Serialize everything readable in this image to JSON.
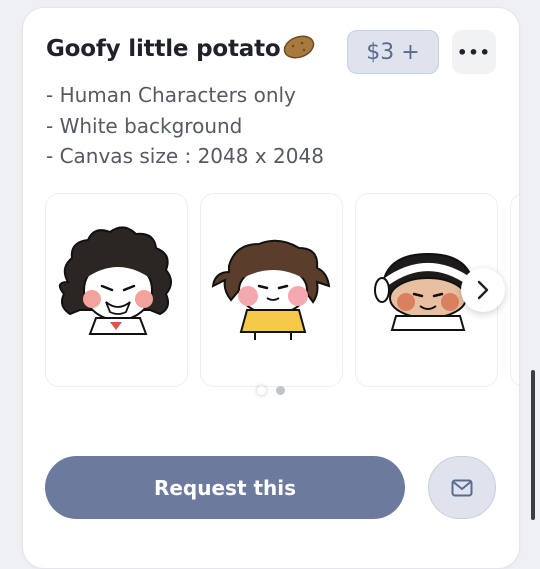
{
  "listing": {
    "title": "Goofy little potato",
    "title_emoji_icon": "potato-icon",
    "price_label": "$3 +",
    "more_icon": "more-horizontal-icon",
    "description_lines": [
      "- Human Characters only",
      "- White background",
      "- Canvas size : 2048 x 2048"
    ]
  },
  "gallery": {
    "thumbnails": [
      {
        "name": "curly-hair-character-sample"
      },
      {
        "name": "messy-hair-yellow-shirt-sample"
      },
      {
        "name": "headband-character-sample"
      }
    ],
    "next_icon": "chevron-right-icon",
    "page_count": 2,
    "current_page": 1
  },
  "actions": {
    "request_label": "Request this",
    "message_icon": "mail-icon"
  },
  "colors": {
    "accent": "#6c7a9e",
    "accent_light": "#dfe3ee",
    "text_primary": "#1f2329",
    "text_secondary": "#555a63"
  }
}
